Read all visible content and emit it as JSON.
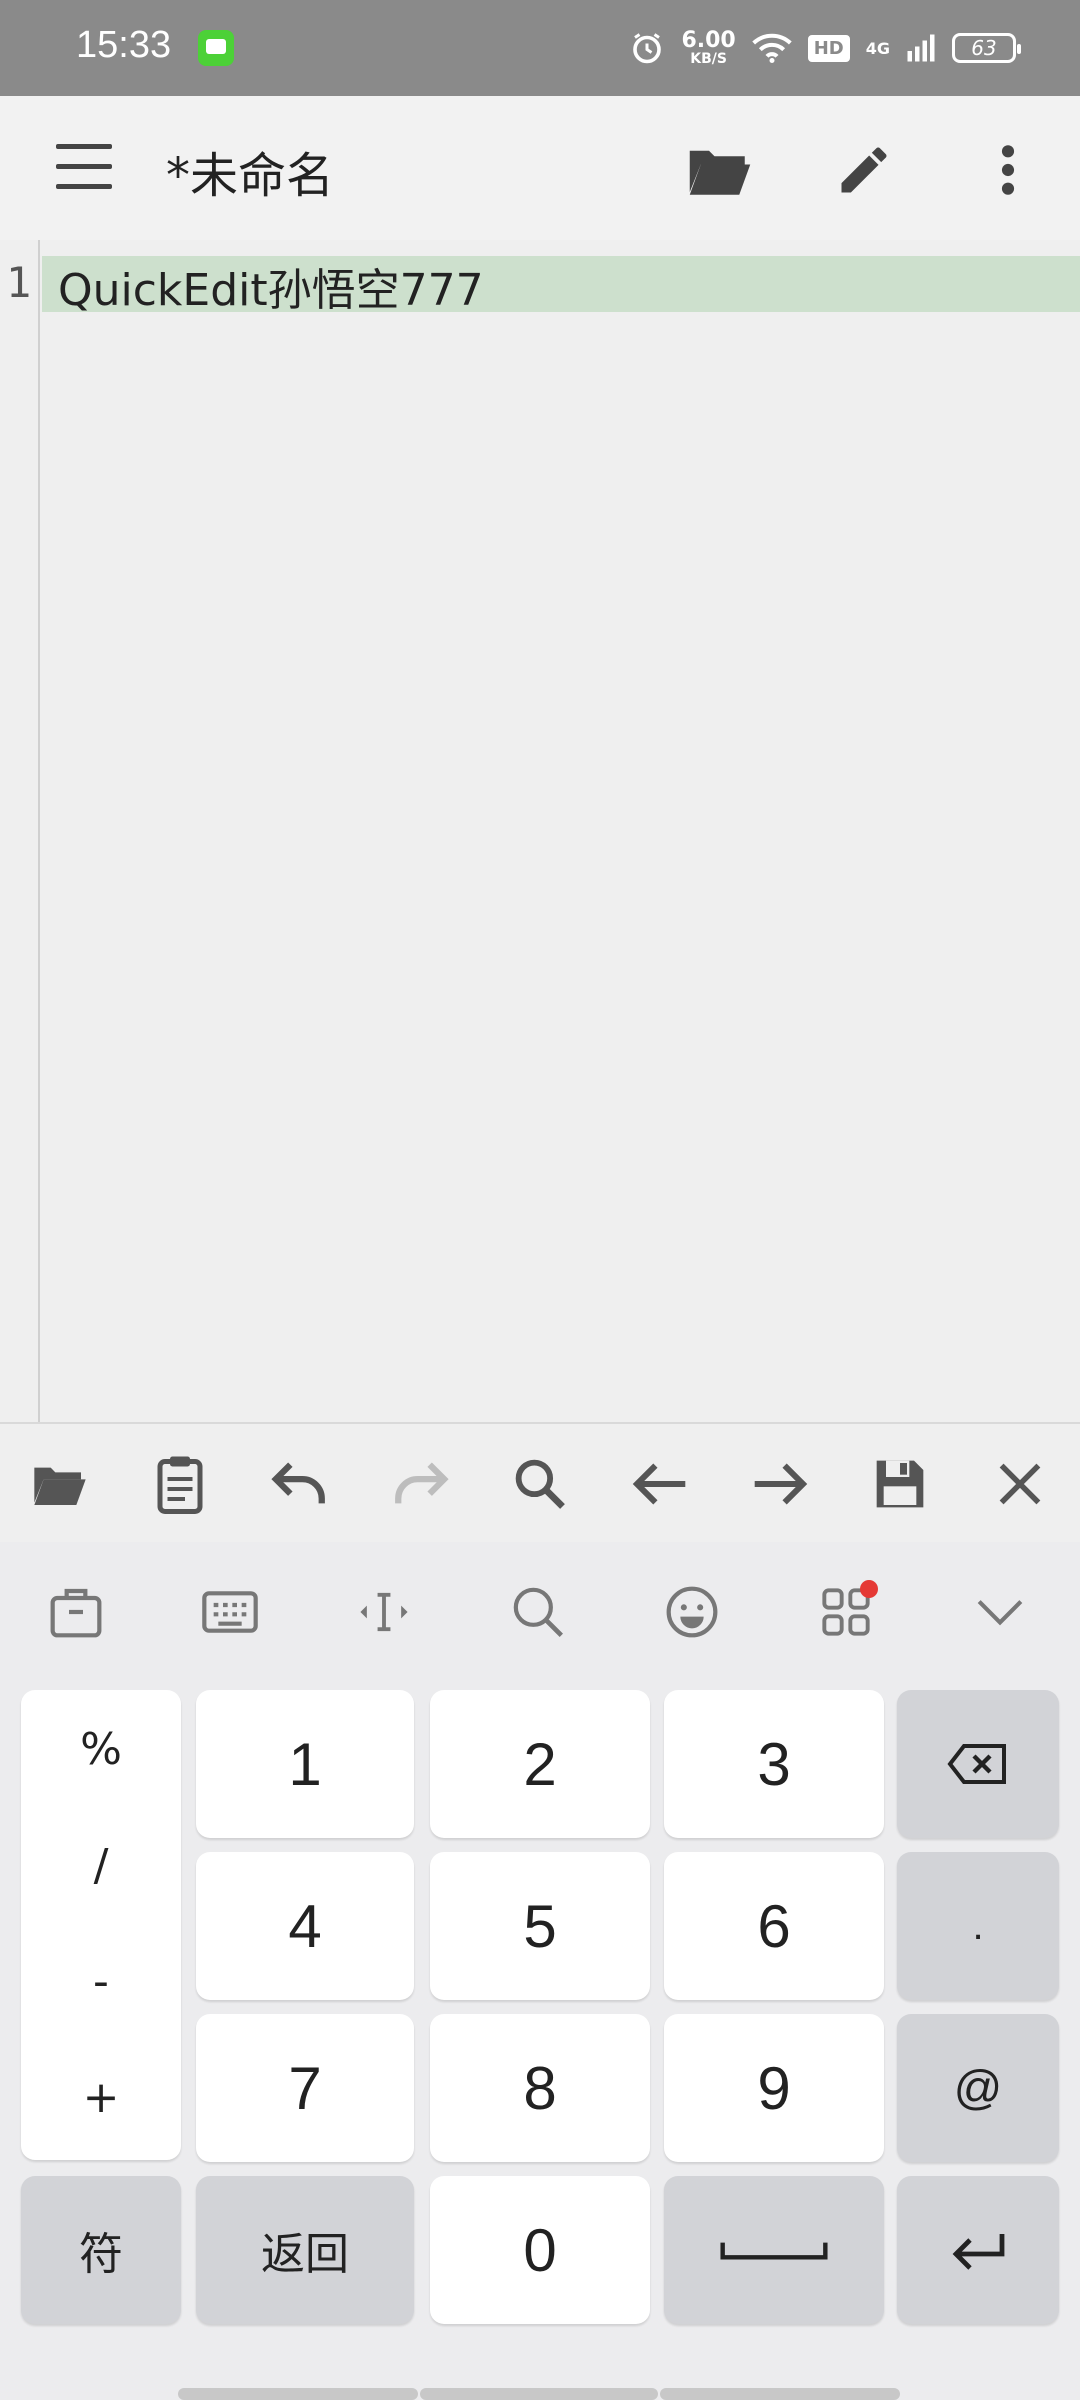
{
  "status_bar": {
    "time": "15:33",
    "speed_value": "6.00",
    "speed_unit": "KB/S",
    "hd": "HD",
    "network": "4G",
    "battery": "63",
    "icons": [
      "message-app-icon",
      "alarm-icon",
      "wifi-icon",
      "signal-icon",
      "battery-icon"
    ]
  },
  "appbar": {
    "title": "*未命名",
    "icons": [
      "menu-icon",
      "folder-open-icon",
      "edit-pencil-icon",
      "more-vert-icon"
    ]
  },
  "editor": {
    "lines": [
      {
        "number": "1",
        "text": "QuickEdit孙悟空777"
      }
    ],
    "highlight_color": "#cde0cd"
  },
  "edit_toolbar": {
    "icons": [
      "open-folder-icon",
      "clipboard-icon",
      "undo-icon",
      "redo-icon",
      "search-icon",
      "arrow-left-icon",
      "arrow-right-icon",
      "save-icon",
      "close-icon"
    ]
  },
  "keyboard": {
    "toolbar_icons": [
      "clipboard-bag-icon",
      "keyboard-icon",
      "cursor-move-icon",
      "search-icon",
      "emoji-icon",
      "apps-grid-icon",
      "collapse-chevron-icon"
    ],
    "symbols": [
      "%",
      "/",
      "-",
      "+"
    ],
    "digits": [
      "1",
      "2",
      "3",
      "4",
      "5",
      "6",
      "7",
      "8",
      "9",
      "0"
    ],
    "dot_key": ".",
    "at_key": "@",
    "symbol_switch": "符",
    "back_key": "返回"
  },
  "colors": {
    "status_bar": "#8a8a8a",
    "appbar": "#f2f2f2",
    "accent_green": "#4cd137",
    "notification_dot": "#e53935"
  }
}
